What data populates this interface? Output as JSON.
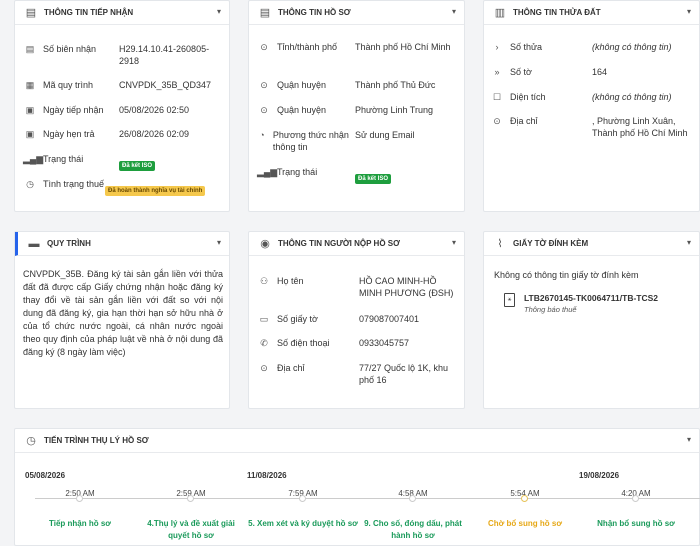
{
  "cards": {
    "tiep_nhan": {
      "title": "THÔNG TIN TIẾP NHẬN",
      "rows": [
        {
          "label": "Số biên nhận",
          "value": "H29.14.10.41-260805-2918"
        },
        {
          "label": "Mã quy trình",
          "value": "CNVPDK_35B_QD347"
        },
        {
          "label": "Ngày tiếp nhận",
          "value": "05/08/2026 02:50"
        },
        {
          "label": "Ngày hẹn trả",
          "value": "26/08/2026 02:09"
        },
        {
          "label": "Trạng thái",
          "badge": "Đã kết ISO"
        },
        {
          "label": "Tình trạng thuế",
          "badge": "Đã hoàn thành nghĩa vụ tài chính"
        }
      ]
    },
    "ho_so": {
      "title": "THÔNG TIN HỒ SƠ",
      "rows": [
        {
          "label": "Tỉnh/thành phố",
          "value": "Thành phố Hồ Chí Minh"
        },
        {
          "label": "Quận huyện",
          "value": "Thành phố Thủ Đức"
        },
        {
          "label": "Quận huyện",
          "value": "Phường Linh Trung"
        },
        {
          "label": "Phương thức nhận thông tin",
          "value": "Sử dung Email"
        },
        {
          "label": "Trạng thái",
          "badge": "Đã kết ISO"
        }
      ]
    },
    "thua_dat": {
      "title": "THÔNG TIN THỬA ĐẤT",
      "rows": [
        {
          "label": "Số thửa",
          "value": "(không có thông tin)"
        },
        {
          "label": "Số tờ",
          "value": "164"
        },
        {
          "label": "Diện tích",
          "value": "(không có thông tin)"
        },
        {
          "label": "Địa chỉ",
          "value": ", Phường Linh Xuân, Thành phố Hồ Chí Minh"
        }
      ]
    },
    "quy_trinh": {
      "title": "QUY TRÌNH",
      "text": "CNVPDK_35B. Đăng ký tài sản gắn liền với thửa đất đã được cấp Giấy chứng nhận hoặc đăng ký thay đổi về tài sản gắn liền với đất so với nội dung đã đăng ký, gia hạn thời hạn sở hữu nhà ở của tổ chức nước ngoài, cá nhân nước ngoài theo quy định của pháp luật về nhà ở nội dung đã đăng ký (8 ngày làm việc)"
    },
    "nguoi_nop": {
      "title": "THÔNG TIN NGƯỜI NỘP HỒ SƠ",
      "rows": [
        {
          "label": "Họ tên",
          "value": "HỒ CAO MINH-HỒ MINH PHƯƠNG (ĐSH)"
        },
        {
          "label": "Số giấy tờ",
          "value": "079087007401"
        },
        {
          "label": "Số điện thoại",
          "value": "0933045757"
        },
        {
          "label": "Địa chỉ",
          "value": "77/27 Quốc lộ 1K, khu phố 16"
        }
      ]
    },
    "dinh_kem": {
      "title": "GIẤY TỜ ĐÍNH KÈM",
      "empty_text": "Không có thông tin giấy tờ đính kèm",
      "file_name": "LTB2670145-TK0064711/TB-TCS2",
      "file_desc": "Thông báo thuế"
    },
    "tien_trinh": {
      "title": "TIẾN TRÌNH THỤ LÝ HỒ SƠ",
      "dates": [
        "05/08/2026",
        "11/08/2026",
        "19/08/2026"
      ],
      "steps": [
        {
          "time": "2:50 AM",
          "label": "Tiếp nhận hồ sơ"
        },
        {
          "time": "2:59 AM",
          "label": "4.Thụ lý và đề xuất giải quyết hồ sơ"
        },
        {
          "time": "7:59 AM",
          "label": "5. Xem xét và ký duyệt hồ sơ"
        },
        {
          "time": "4:58 AM",
          "label": "9. Cho số, đóng dấu, phát hành hồ sơ"
        },
        {
          "time": "5:54 AM",
          "label": "Chờ bổ sung hồ sơ"
        },
        {
          "time": "4:20 AM",
          "label": "Nhận bổ sung hồ sơ"
        }
      ]
    }
  }
}
